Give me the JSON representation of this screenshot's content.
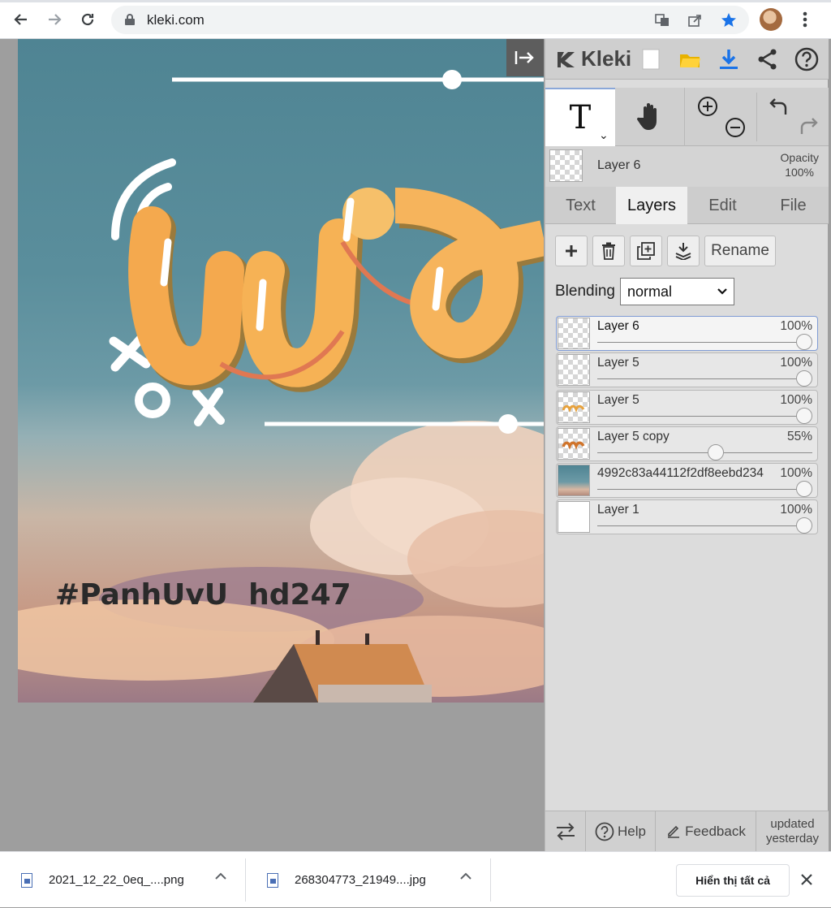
{
  "browser": {
    "url": "kleki.com",
    "icons": [
      "back-arrow-icon",
      "forward-arrow-icon",
      "reload-icon",
      "lock-icon",
      "translate-icon",
      "share-icon",
      "star-icon",
      "avatar",
      "kebab-menu-icon"
    ]
  },
  "colors": {
    "accent": "#8aa7d8",
    "download_blue": "#1a73e8",
    "star_blue": "#1a73e8",
    "panel_bg": "#dcdcdc",
    "canvas_bg": "#9e9e9e"
  },
  "canvas": {
    "watermark": "#PanhUvU  hd247"
  },
  "app": {
    "name": "Kleki",
    "top_icons": [
      "new-image-icon",
      "open-folder-icon",
      "download-icon",
      "share-icon",
      "help-icon"
    ],
    "tools": [
      "text-tool",
      "hand-tool",
      "zoom-in",
      "zoom-out",
      "undo",
      "redo"
    ],
    "current_layer": {
      "name": "Layer 6",
      "opacity_label": "Opacity",
      "opacity_value": "100%"
    },
    "tabs": [
      {
        "label": "Text",
        "active": false
      },
      {
        "label": "Layers",
        "active": true
      },
      {
        "label": "Edit",
        "active": false
      },
      {
        "label": "File",
        "active": false
      }
    ],
    "layer_actions": {
      "rename_label": "Rename"
    },
    "blending": {
      "label": "Blending",
      "value": "normal"
    },
    "layers": [
      {
        "name": "Layer 6",
        "opacity": "100%",
        "opacity_level": 1.0,
        "selected": true
      },
      {
        "name": "Layer 5",
        "opacity": "100%",
        "opacity_level": 1.0,
        "selected": false
      },
      {
        "name": "Layer 5",
        "opacity": "100%",
        "opacity_level": 1.0,
        "selected": false
      },
      {
        "name": "Layer 5 copy",
        "opacity": "55%",
        "opacity_level": 0.55,
        "selected": false
      },
      {
        "name": "4992c83a44112f2df8eebd234",
        "opacity": "100%",
        "opacity_level": 1.0,
        "selected": false
      },
      {
        "name": "Layer 1",
        "opacity": "100%",
        "opacity_level": 1.0,
        "selected": false
      }
    ],
    "footer": {
      "help_label": "Help",
      "feedback_label": "Feedback",
      "updated_line1": "updated",
      "updated_line2": "yesterday"
    }
  },
  "downloads": {
    "items": [
      {
        "name": "2021_12_22_0eq_....png"
      },
      {
        "name": "268304773_21949....jpg"
      }
    ],
    "show_all_label": "Hiển thị tất cả"
  }
}
